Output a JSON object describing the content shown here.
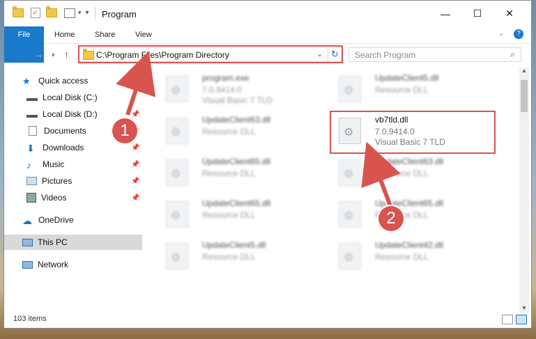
{
  "window": {
    "title": "Program",
    "minimize_label": "—",
    "maximize_label": "☐",
    "close_label": "✕"
  },
  "ribbon": {
    "tabs": [
      "File",
      "Home",
      "Share",
      "View"
    ]
  },
  "address": {
    "path": "C:\\Program Files\\Program Directory",
    "search_placeholder": "Search Program"
  },
  "sidebar": {
    "items": [
      {
        "label": "Quick access"
      },
      {
        "label": "Local Disk (C:)"
      },
      {
        "label": "Local Disk (D:)"
      },
      {
        "label": "Documents"
      },
      {
        "label": "Downloads"
      },
      {
        "label": "Music"
      },
      {
        "label": "Pictures"
      },
      {
        "label": "Videos"
      },
      {
        "label": "OneDrive"
      },
      {
        "label": "This PC"
      },
      {
        "label": "Network"
      }
    ]
  },
  "files": {
    "left": [
      {
        "name": "program.exe",
        "line2": "7.0.9414.0",
        "line3": "Visual Basic 7 TLD"
      },
      {
        "name": "UpdateClient63.dll",
        "line2": "Resource DLL"
      },
      {
        "name": "UpdateClient65.dll",
        "line2": "Resource DLL"
      },
      {
        "name": "UpdateClient65.dll",
        "line2": "Resource DLL"
      },
      {
        "name": "UpdateClient5.dll",
        "line2": "Resource DLL"
      }
    ],
    "right": [
      {
        "name": "UpdateClient5.dll",
        "line2": "Resource DLL"
      },
      {
        "name": "vb7tld.dll",
        "line2": "7.0.9414.0",
        "line3": "Visual Basic 7 TLD"
      },
      {
        "name": "UpdateClient63.dll",
        "line2": "Resource DLL"
      },
      {
        "name": "UpdateClient65.dll",
        "line2": "Resource DLL"
      },
      {
        "name": "UpdateClient42.dll",
        "line2": "Resource DLL"
      }
    ]
  },
  "status": {
    "items_count": "103 items"
  },
  "annotations": {
    "step1": "1",
    "step2": "2",
    "color": "#d9534f"
  }
}
